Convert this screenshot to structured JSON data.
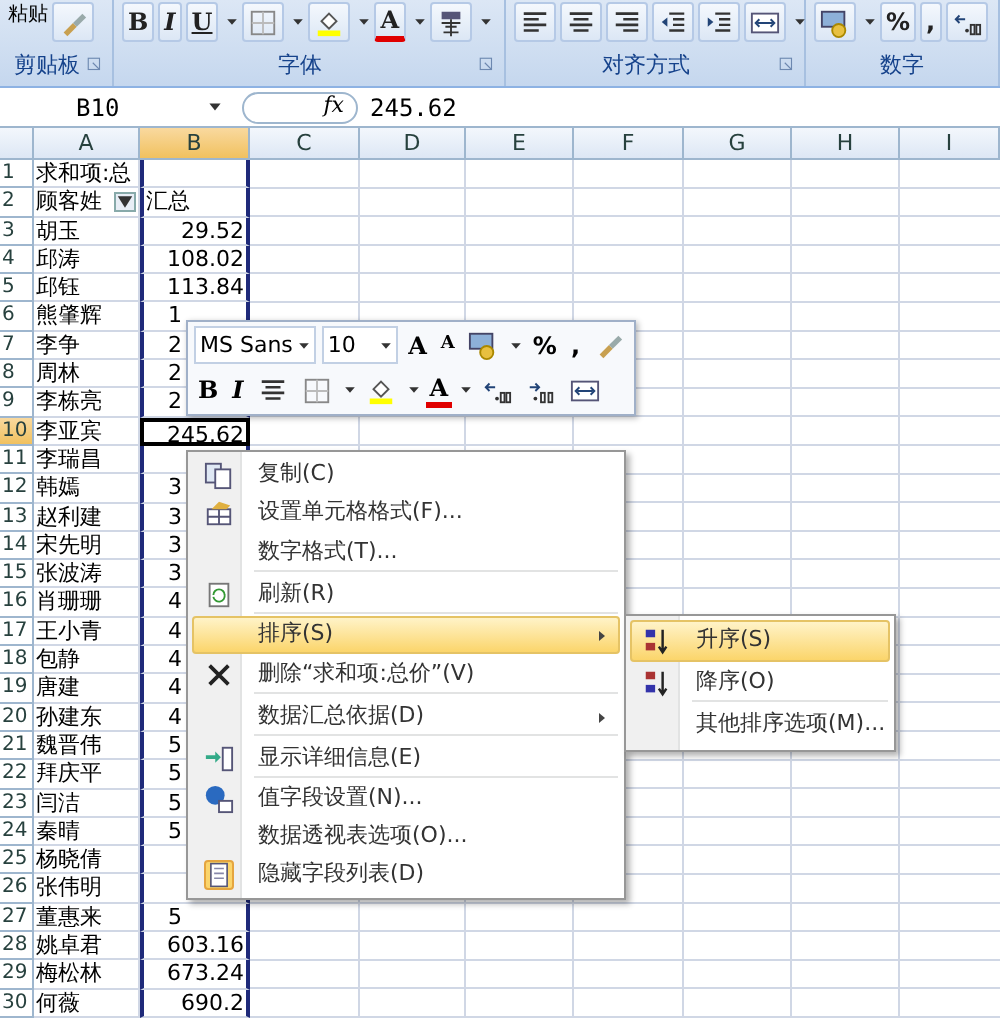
{
  "ribbon": {
    "paste_label": "粘贴",
    "groups": [
      {
        "label": "剪贴板",
        "launcher": true,
        "buttons": [
          {
            "kind": "brush"
          }
        ]
      },
      {
        "label": "字体",
        "launcher": true,
        "buttons": [
          {
            "kind": "bold",
            "text": "B"
          },
          {
            "kind": "italic",
            "text": "I"
          },
          {
            "kind": "underline",
            "text": "U",
            "dropdown": true
          },
          {
            "kind": "border",
            "dropdown": true
          },
          {
            "kind": "fill",
            "dropdown": true
          },
          {
            "kind": "font-color",
            "text": "A",
            "dropdown": true
          },
          {
            "kind": "phonetic",
            "dropdown": true
          }
        ]
      },
      {
        "label": "对齐方式",
        "launcher": true,
        "buttons": [
          {
            "kind": "align-left"
          },
          {
            "kind": "align-center"
          },
          {
            "kind": "align-right"
          },
          {
            "kind": "indent-less"
          },
          {
            "kind": "indent-more"
          },
          {
            "kind": "merge",
            "dropdown": true
          }
        ]
      },
      {
        "label": "数字",
        "buttons": [
          {
            "kind": "currency",
            "dropdown": true
          },
          {
            "kind": "percent",
            "text": "%"
          },
          {
            "kind": "comma",
            "text": ","
          },
          {
            "kind": "decimal-more"
          }
        ]
      }
    ]
  },
  "formula_bar": {
    "name_box": "B10",
    "fx_label": "fx",
    "formula": "245.62"
  },
  "sheet": {
    "columns": [
      {
        "label": "A",
        "selected": false
      },
      {
        "label": "B",
        "selected": true
      },
      {
        "label": "C",
        "selected": false
      },
      {
        "label": "D",
        "selected": false
      },
      {
        "label": "E",
        "selected": false
      },
      {
        "label": "F",
        "selected": false
      },
      {
        "label": "G",
        "selected": false
      },
      {
        "label": "H",
        "selected": false
      },
      {
        "label": "I",
        "selected": false
      }
    ],
    "rows": [
      {
        "n": "1",
        "a": "求和项:总",
        "selected": false
      },
      {
        "n": "2",
        "a": "顾客姓",
        "filter": true,
        "b": "汇总",
        "kind": "text",
        "selected": false
      },
      {
        "n": "3",
        "a": "胡玉",
        "b": "29.52",
        "kind": "number",
        "selected": false
      },
      {
        "n": "4",
        "a": "邱涛",
        "b": "108.02",
        "kind": "number",
        "selected": false
      },
      {
        "n": "5",
        "a": "邱钰",
        "b": "113.84",
        "kind": "number",
        "selected": false
      },
      {
        "n": "6",
        "a": "熊肇辉",
        "b": "1",
        "kind": "partial",
        "selected": false
      },
      {
        "n": "7",
        "a": "李争",
        "b": "2",
        "kind": "partial",
        "selected": false
      },
      {
        "n": "8",
        "a": "周林",
        "b": "2",
        "kind": "partial",
        "selected": false
      },
      {
        "n": "9",
        "a": "李栋亮",
        "b": "2",
        "kind": "partial",
        "selected": false
      },
      {
        "n": "10",
        "a": "李亚宾",
        "b": "245.62",
        "kind": "number",
        "selected": true
      },
      {
        "n": "11",
        "a": "李瑞昌",
        "selected": false
      },
      {
        "n": "12",
        "a": "韩嫣",
        "b": "3",
        "kind": "partial",
        "selected": false
      },
      {
        "n": "13",
        "a": "赵利建",
        "b": "3",
        "kind": "partial",
        "selected": false
      },
      {
        "n": "14",
        "a": "宋先明",
        "b": "3",
        "kind": "partial",
        "selected": false
      },
      {
        "n": "15",
        "a": "张波涛",
        "b": "3",
        "kind": "partial",
        "selected": false
      },
      {
        "n": "16",
        "a": "肖珊珊",
        "b": "4",
        "kind": "partial",
        "selected": false
      },
      {
        "n": "17",
        "a": "王小青",
        "b": "4",
        "kind": "partial",
        "selected": false
      },
      {
        "n": "18",
        "a": "包静",
        "b": "4",
        "kind": "partial",
        "selected": false
      },
      {
        "n": "19",
        "a": "唐建",
        "b": "4",
        "kind": "partial",
        "selected": false
      },
      {
        "n": "20",
        "a": "孙建东",
        "b": "4",
        "kind": "partial",
        "selected": false
      },
      {
        "n": "21",
        "a": "魏晋伟",
        "b": "5",
        "kind": "partial",
        "selected": false
      },
      {
        "n": "22",
        "a": "拜庆平",
        "b": "5",
        "kind": "partial",
        "selected": false
      },
      {
        "n": "23",
        "a": "闫洁",
        "b": "5",
        "kind": "partial",
        "selected": false
      },
      {
        "n": "24",
        "a": "秦晴",
        "b": "5",
        "kind": "partial",
        "selected": false
      },
      {
        "n": "25",
        "a": "杨晓倩",
        "selected": false
      },
      {
        "n": "26",
        "a": "张伟明",
        "selected": false
      },
      {
        "n": "27",
        "a": "董惠来",
        "b": "5",
        "kind": "partial",
        "selected": false
      },
      {
        "n": "28",
        "a": "姚卓君",
        "b": "603.16",
        "kind": "number",
        "selected": false
      },
      {
        "n": "29",
        "a": "梅松林",
        "b": "673.24",
        "kind": "number",
        "selected": false
      },
      {
        "n": "30",
        "a": "何薇",
        "b": "690.2",
        "kind": "number",
        "selected": false
      }
    ]
  },
  "mini_toolbar": {
    "font_name": "MS Sans",
    "font_size": "10",
    "row1": [
      {
        "kind": "grow-font",
        "text": "A"
      },
      {
        "kind": "shrink-font",
        "text": "A"
      },
      {
        "kind": "currency",
        "dropdown": true
      },
      {
        "kind": "percent",
        "text": "%"
      },
      {
        "kind": "comma",
        "text": ","
      },
      {
        "kind": "brush"
      }
    ],
    "row2": [
      {
        "kind": "bold",
        "text": "B"
      },
      {
        "kind": "italic",
        "text": "I"
      },
      {
        "kind": "align-center"
      },
      {
        "kind": "border",
        "dropdown": true
      },
      {
        "kind": "fill",
        "dropdown": true
      },
      {
        "kind": "font-color",
        "text": "A",
        "dropdown": true
      },
      {
        "kind": "decimal-more"
      },
      {
        "kind": "decimal-less"
      },
      {
        "kind": "merge"
      }
    ]
  },
  "context_menu": [
    {
      "text": "复制(C)",
      "selected": false,
      "checked": false,
      "submenu": false,
      "separator_after": false
    },
    {
      "text": "设置单元格格式(F)...",
      "selected": false,
      "checked": false,
      "submenu": false,
      "separator_after": false
    },
    {
      "text": "数字格式(T)...",
      "selected": false,
      "checked": false,
      "submenu": false,
      "separator_after": true
    },
    {
      "text": "刷新(R)",
      "selected": false,
      "checked": false,
      "submenu": false,
      "separator_after": true
    },
    {
      "text": "排序(S)",
      "selected": true,
      "checked": false,
      "submenu": true,
      "separator_after": false
    },
    {
      "text": "删除“求和项:总价”(V)",
      "selected": false,
      "checked": false,
      "submenu": false,
      "separator_after": true
    },
    {
      "text": "数据汇总依据(D)",
      "selected": false,
      "checked": false,
      "submenu": true,
      "separator_after": true
    },
    {
      "text": "显示详细信息(E)",
      "selected": false,
      "checked": false,
      "submenu": false,
      "separator_after": true
    },
    {
      "text": "值字段设置(N)...",
      "selected": false,
      "checked": false,
      "submenu": false,
      "separator_after": false
    },
    {
      "text": "数据透视表选项(O)...",
      "selected": false,
      "checked": false,
      "submenu": false,
      "separator_after": false
    },
    {
      "text": "隐藏字段列表(D)",
      "selected": false,
      "checked": true,
      "submenu": false,
      "separator_after": false
    }
  ],
  "sort_submenu": [
    {
      "text": "升序(S)",
      "selected": true,
      "separator_after": false
    },
    {
      "text": "降序(O)",
      "selected": false,
      "separator_after": true
    },
    {
      "text": "其他排序选项(M)...",
      "selected": false,
      "separator_after": false
    }
  ]
}
